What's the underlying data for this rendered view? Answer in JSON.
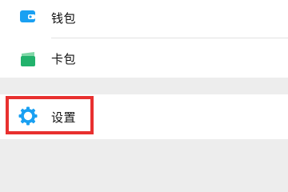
{
  "menu": {
    "items": [
      {
        "label": "钱包",
        "icon": "wallet-icon"
      },
      {
        "label": "卡包",
        "icon": "card-pack-icon"
      }
    ],
    "settings": {
      "label": "设置",
      "icon": "settings-gear-icon"
    }
  },
  "colors": {
    "wallet_icon": "#1aa0f2",
    "cards_icon": "#22b26c",
    "settings_icon": "#1aa0f2",
    "highlight_border": "#e8302f",
    "group_background": "#ffffff",
    "page_background": "#ededed"
  }
}
